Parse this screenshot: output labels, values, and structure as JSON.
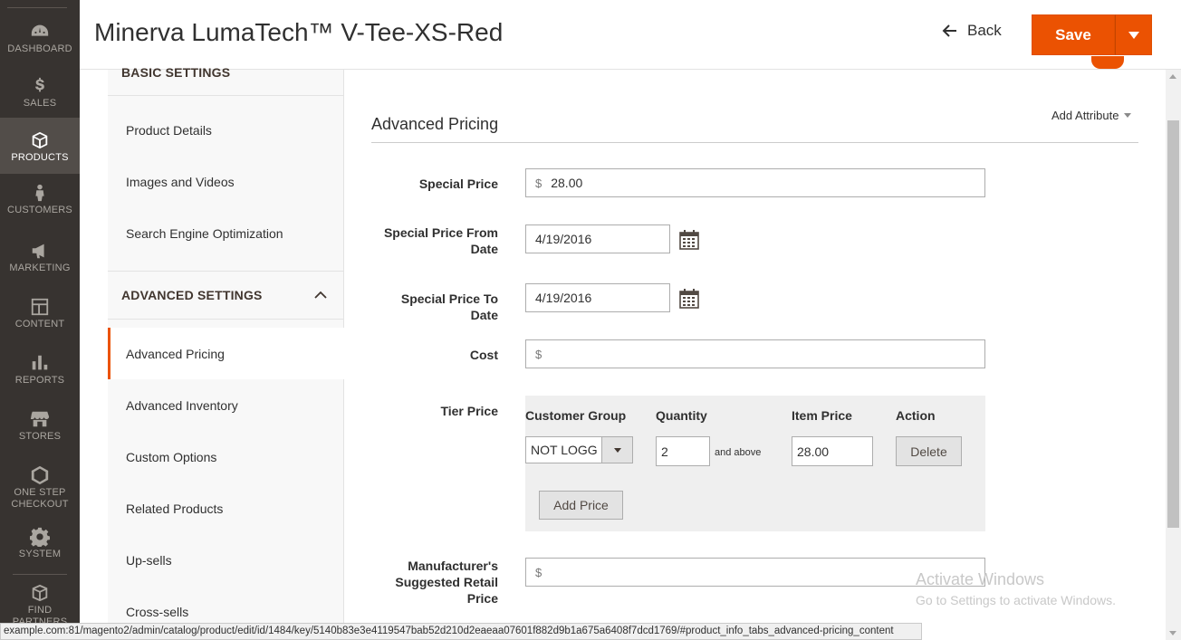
{
  "header": {
    "title": "Minerva LumaTech™ V-Tee-XS-Red",
    "back_label": "Back",
    "save_label": "Save"
  },
  "admin_nav": [
    {
      "label": "DASHBOARD",
      "icon": "dashboard-icon"
    },
    {
      "label": "SALES",
      "icon": "dollar-icon"
    },
    {
      "label": "PRODUCTS",
      "icon": "cube-icon",
      "active": true
    },
    {
      "label": "CUSTOMERS",
      "icon": "person-icon"
    },
    {
      "label": "MARKETING",
      "icon": "megaphone-icon"
    },
    {
      "label": "CONTENT",
      "icon": "layout-icon"
    },
    {
      "label": "REPORTS",
      "icon": "bar-chart-icon"
    },
    {
      "label": "STORES",
      "icon": "storefront-icon"
    },
    {
      "label_line1": "ONE STEP",
      "label_line2": "CHECKOUT",
      "icon": "hexagon-icon"
    },
    {
      "label": "SYSTEM",
      "icon": "gear-icon"
    },
    {
      "label": "FIND PARTNERS",
      "icon": "box-icon"
    }
  ],
  "side_tabs": {
    "basic_heading": "BASIC SETTINGS",
    "basic_items": [
      "Product Details",
      "Images and Videos",
      "Search Engine Optimization"
    ],
    "advanced_heading": "ADVANCED SETTINGS",
    "advanced_items": [
      "Advanced Pricing",
      "Advanced Inventory",
      "Custom Options",
      "Related Products",
      "Up-sells",
      "Cross-sells"
    ]
  },
  "advanced_pricing": {
    "title": "Advanced Pricing",
    "add_attribute": "Add Attribute",
    "special_price_label": "Special Price",
    "special_price_value": "28.00",
    "currency": "$",
    "from_label_line1": "Special Price From",
    "from_label_line2": "Date",
    "from_value": "4/19/2016",
    "to_label": "Special Price To Date",
    "to_value": "4/19/2016",
    "cost_label": "Cost",
    "cost_value": "",
    "tier_label": "Tier Price",
    "tier": {
      "col_group": "Customer Group",
      "col_qty": "Quantity",
      "col_price": "Item Price",
      "col_action": "Action",
      "group_value": "NOT LOGG",
      "qty_value": "2",
      "and_above": "and above",
      "price_value": "28.00",
      "delete_label": "Delete",
      "add_price_label": "Add Price"
    },
    "msrp_label_line1": "Manufacturer's",
    "msrp_label_line2": "Suggested Retail",
    "msrp_label_line3": "Price",
    "msrp_value": ""
  },
  "watermark": {
    "line1": "Activate Windows",
    "line2": "Go to Settings to activate Windows."
  },
  "status_url": "example.com:81/magento2/admin/catalog/product/edit/id/1484/key/5140b83e3e4119547bab52d210d2eaeaa07601f882d9b1a675a6408f7dcd1769/#product_info_tabs_advanced-pricing_content",
  "colors": {
    "accent": "#eb5202",
    "nav_bg": "#373330"
  }
}
